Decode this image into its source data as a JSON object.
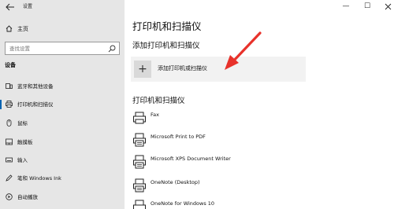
{
  "window": {
    "title": "设置",
    "back_icon": "back-arrow-icon",
    "minimize": "—",
    "maximize": "☐"
  },
  "sidebar": {
    "home_label": "主页",
    "search_placeholder": "查找设置",
    "section_label": "设备",
    "items": [
      {
        "label": "蓝牙和其他设备",
        "icon": "bluetooth-devices-icon",
        "active": false
      },
      {
        "label": "打印机和扫描仪",
        "icon": "printer-icon",
        "active": true
      },
      {
        "label": "鼠标",
        "icon": "mouse-icon",
        "active": false
      },
      {
        "label": "触摸板",
        "icon": "touchpad-icon",
        "active": false
      },
      {
        "label": "输入",
        "icon": "keyboard-icon",
        "active": false
      },
      {
        "label": "笔和 Windows Ink",
        "icon": "pen-icon",
        "active": false
      },
      {
        "label": "自动播放",
        "icon": "autoplay-icon",
        "active": false
      }
    ]
  },
  "main": {
    "title": "打印机和扫描仪",
    "add_section_title": "添加打印机和扫描仪",
    "add_button_label": "添加打印机或扫描仪",
    "list_title": "打印机和扫描仪",
    "printers": [
      {
        "name": "Fax",
        "icon": "fax-icon"
      },
      {
        "name": "Microsoft Print to PDF",
        "icon": "printer-icon"
      },
      {
        "name": "Microsoft XPS Document Writer",
        "icon": "printer-icon"
      },
      {
        "name": "OneNote (Desktop)",
        "icon": "printer-icon"
      },
      {
        "name": "OneNote for Windows 10",
        "icon": "printer-icon"
      }
    ]
  },
  "annotation": {
    "icon": "red-arrow-icon",
    "color": "#e8322b"
  },
  "colors": {
    "accent": "#0063b1",
    "sidebar_bg": "#e6e6e6"
  }
}
